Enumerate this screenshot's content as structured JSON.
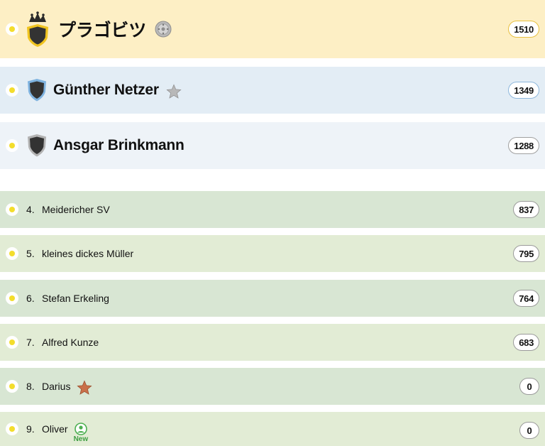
{
  "top_players": [
    {
      "name": "プラゴビツ",
      "score": "1510",
      "tier": "gold",
      "badge_icon": "disc-badge-icon"
    },
    {
      "name": "Günther Netzer",
      "score": "1349",
      "tier": "silver",
      "badge_icon": "silver-star-icon"
    },
    {
      "name": "Ansgar Brinkmann",
      "score": "1288",
      "tier": "bronze"
    }
  ],
  "players": [
    {
      "rank": "4.",
      "name": "Meidericher SV",
      "score": "837"
    },
    {
      "rank": "5.",
      "name": "kleines dickes Müller",
      "score": "795"
    },
    {
      "rank": "6.",
      "name": "Stefan Erkeling",
      "score": "764"
    },
    {
      "rank": "7.",
      "name": "Alfred Kunze",
      "score": "683"
    },
    {
      "rank": "8.",
      "name": "Darius",
      "score": "0",
      "badge_icon": "bronze-star-icon"
    },
    {
      "rank": "9.",
      "name": "Oliver",
      "score": "0",
      "badge_icon": "new-user-icon",
      "badge_label": "New"
    }
  ],
  "colors": {
    "gold_row": "#fdefc5",
    "silver_row": "#e3edf5",
    "third_row": "#eef3f8",
    "list_row_a": "#d8e6d3",
    "list_row_b": "#e2ecd5",
    "status_dot": "#f3dd2c"
  }
}
